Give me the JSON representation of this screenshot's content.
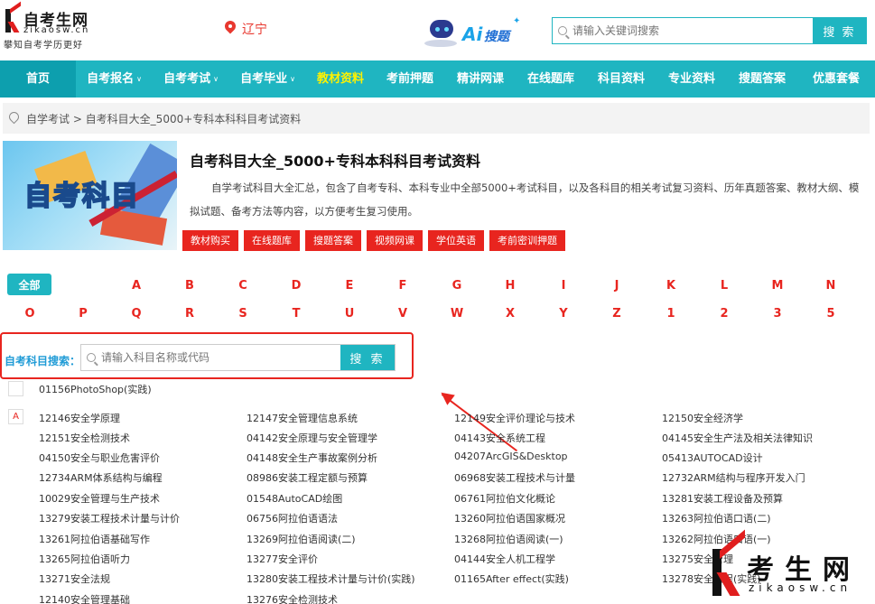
{
  "header": {
    "logo_title": "自考生网",
    "logo_domain": "zikaosw.cn",
    "logo_slogan": "攀知自考学历更好",
    "location": "辽宁",
    "ai_text": "Ai",
    "ai_sub": "搜题",
    "search_placeholder": "请输入关键词搜索",
    "search_button": "搜 索"
  },
  "nav": {
    "items": [
      {
        "label": "首页"
      },
      {
        "label": "自考报名"
      },
      {
        "label": "自考考试"
      },
      {
        "label": "自考毕业"
      },
      {
        "label": "教材资料"
      },
      {
        "label": "考前押题"
      },
      {
        "label": "精讲网课"
      },
      {
        "label": "在线题库"
      },
      {
        "label": "科目资料"
      },
      {
        "label": "专业资料"
      },
      {
        "label": "搜题答案"
      },
      {
        "label": "优惠套餐"
      }
    ]
  },
  "breadcrumb": {
    "text": "自学考试 > 自考科目大全_5000+专科本科科目考试资料"
  },
  "intro": {
    "banner_text": "自考科目",
    "title": "自考科目大全_5000+专科本科科目考试资料",
    "description": "自学考试科目大全汇总，包含了自考专科、本科专业中全部5000+考试科目，以及各科目的相关考试复习资料、历年真题答案、教材大纲、模拟试题、备考方法等内容，以方便考生复习使用。",
    "tags": [
      "教材购买",
      "在线题库",
      "搜题答案",
      "视频网课",
      "学位英语",
      "考前密训押题"
    ]
  },
  "letters": {
    "all": "全部",
    "row1": [
      "A",
      "B",
      "C",
      "D",
      "E",
      "F",
      "G",
      "H",
      "I",
      "J",
      "K",
      "L",
      "M",
      "N"
    ],
    "row2": [
      "O",
      "P",
      "Q",
      "R",
      "S",
      "T",
      "U",
      "V",
      "W",
      "X",
      "Y",
      "Z",
      "1",
      "2",
      "3",
      "5"
    ]
  },
  "subject_search": {
    "label": "自考科目搜索：",
    "placeholder": "请输入科目名称或代码",
    "button": "搜 索"
  },
  "subjects": {
    "top": "01156PhotoShop(实践)",
    "group_a_label": "A",
    "group_a": [
      "12146安全学原理",
      "12147安全管理信息系统",
      "12149安全评价理论与技术",
      "12150安全经济学",
      "12151安全检测技术",
      "04142安全原理与安全管理学",
      "04143安全系统工程",
      "04145安全生产法及相关法律知识",
      "04150安全与职业危害评价",
      "04148安全生产事故案例分析",
      "04207ArcGIS&Desktop",
      "05413AUTOCAD设计",
      "12734ARM体系结构与编程",
      "08986安装工程定额与预算",
      "06968安装工程技术与计量",
      "12732ARM结构与程序开发入门",
      "10029安全管理与生产技术",
      "01548AutoCAD绘图",
      "06761阿拉伯文化概论",
      "13281安装工程设备及预算",
      "13279安装工程技术计量与计价",
      "06756阿拉伯语语法",
      "13260阿拉伯语国家概况",
      "13263阿拉伯语口语(二)",
      "13261阿拉伯语基础写作",
      "13269阿拉伯语阅读(二)",
      "13268阿拉伯语阅读(一)",
      "13262阿拉伯语口语(一)",
      "13265阿拉伯语听力",
      "13277安全评价",
      "04144安全人机工程学",
      "13275安全管理",
      "13271安全法规",
      "13280安装工程技术计量与计价(实践)",
      "01165After effect(实践)",
      "13278安全工程(实践)",
      "12140安全管理基础",
      "13276安全检测技术"
    ]
  },
  "watermark": {
    "title": "考生网",
    "domain": "zikaosw.cn"
  }
}
